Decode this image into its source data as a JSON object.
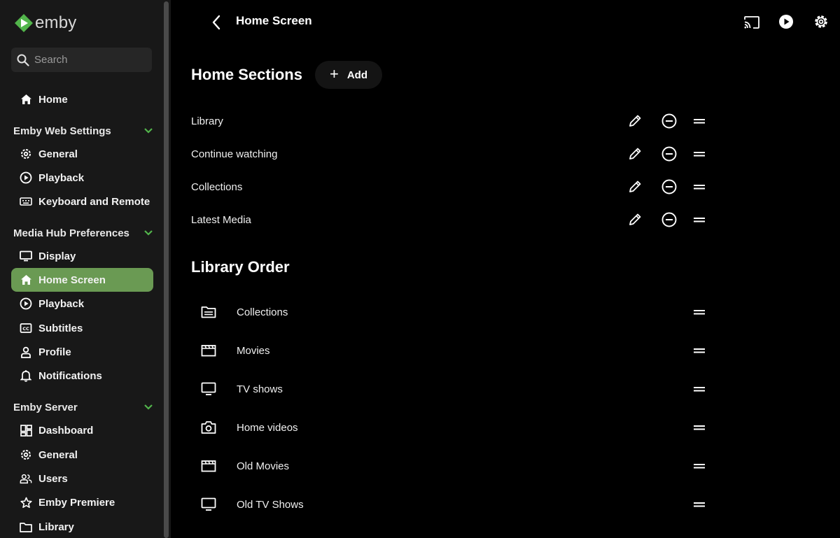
{
  "app": {
    "name": "emby",
    "accent": "#52b54b",
    "active_bg": "#6a9a53"
  },
  "search": {
    "placeholder": "Search"
  },
  "sidebar": {
    "home": "Home",
    "groups": [
      {
        "title": "Emby Web Settings",
        "items": [
          "General",
          "Playback",
          "Keyboard and Remote"
        ]
      },
      {
        "title": "Media Hub Preferences",
        "items": [
          "Display",
          "Home Screen",
          "Playback",
          "Subtitles",
          "Profile",
          "Notifications"
        ]
      },
      {
        "title": "Emby Server",
        "items": [
          "Dashboard",
          "General",
          "Users",
          "Emby Premiere",
          "Library"
        ]
      }
    ],
    "active_item": "Home Screen"
  },
  "header": {
    "title": "Home Screen",
    "icons": [
      "cast-icon",
      "play-icon",
      "settings-icon"
    ]
  },
  "home_sections": {
    "title": "Home Sections",
    "add_label": "Add",
    "items": [
      "Library",
      "Continue watching",
      "Collections",
      "Latest Media"
    ]
  },
  "library_order": {
    "title": "Library Order",
    "items": [
      {
        "label": "Collections",
        "icon": "folder-icon"
      },
      {
        "label": "Movies",
        "icon": "movie-icon"
      },
      {
        "label": "TV shows",
        "icon": "tv-icon"
      },
      {
        "label": "Home videos",
        "icon": "camera-icon"
      },
      {
        "label": "Old Movies",
        "icon": "movie-icon"
      },
      {
        "label": "Old TV Shows",
        "icon": "tv-icon"
      }
    ]
  }
}
